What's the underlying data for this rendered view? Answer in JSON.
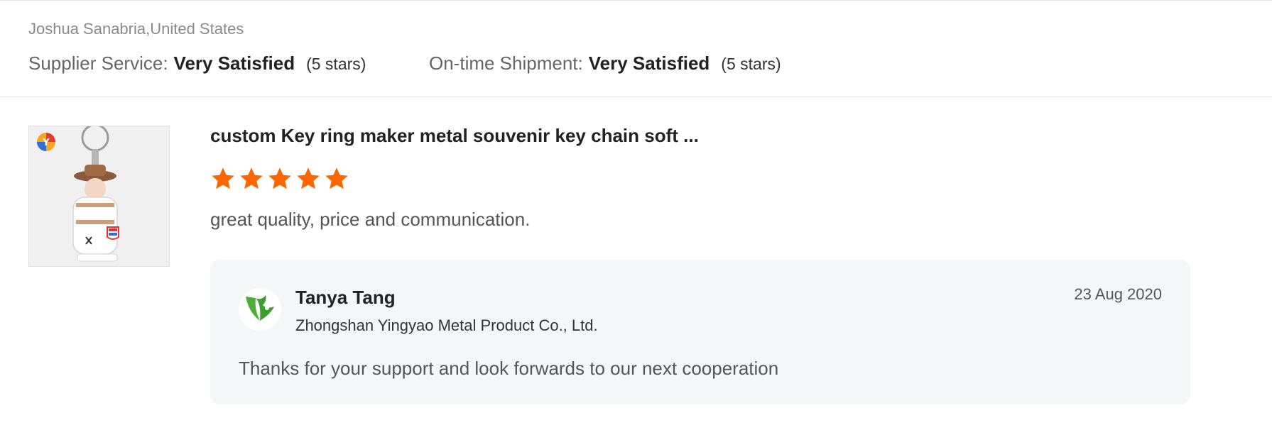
{
  "reviewer": {
    "name_location": "Joshua Sanabria,United States"
  },
  "ratings": [
    {
      "label": "Supplier Service:",
      "value": "Very Satisfied",
      "stars_text": "(5 stars)"
    },
    {
      "label": "On-time Shipment:",
      "value": "Very Satisfied",
      "stars_text": "(5 stars)"
    }
  ],
  "product": {
    "thumbnail_icon": "keychain-product-image",
    "title": "custom Key ring maker metal souvenir key chain soft ...",
    "rating": 5,
    "star_color": "#ff6600",
    "review_text": "great quality, price and communication."
  },
  "reply": {
    "avatar_icon": "deer-logo-icon",
    "name": "Tanya Tang",
    "company": "Zhongshan Yingyao Metal Product Co., Ltd.",
    "date": "23 Aug 2020",
    "text": "Thanks for your support and look forwards to our next cooperation"
  }
}
